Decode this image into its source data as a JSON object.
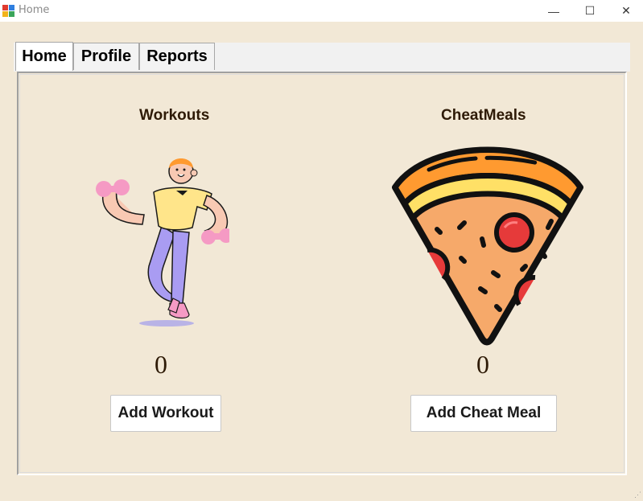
{
  "window": {
    "title": "Home",
    "minimize_glyph": "—",
    "maximize_glyph": "☐",
    "close_glyph": "✕"
  },
  "tabs": [
    {
      "label": "Home",
      "active": true
    },
    {
      "label": "Profile",
      "active": false
    },
    {
      "label": "Reports",
      "active": false
    }
  ],
  "home": {
    "workouts": {
      "label": "Workouts",
      "count": "0",
      "button_label": "Add Workout",
      "icon": "workout-person-illustration"
    },
    "cheat_meals": {
      "label": "CheatMeals",
      "count": "0",
      "button_label": "Add Cheat Meal",
      "icon": "pizza-slice-illustration"
    }
  },
  "colors": {
    "background": "#f2e8d6",
    "text_dark": "#2e1a06",
    "pizza_crust": "#ff9a30",
    "pizza_cheese": "#ffe066",
    "pizza_base": "#f6a96a",
    "pepperoni": "#e63a3a",
    "shirt": "#ffe58a",
    "pants": "#a99cf2",
    "dumbbell": "#f59ac4"
  }
}
